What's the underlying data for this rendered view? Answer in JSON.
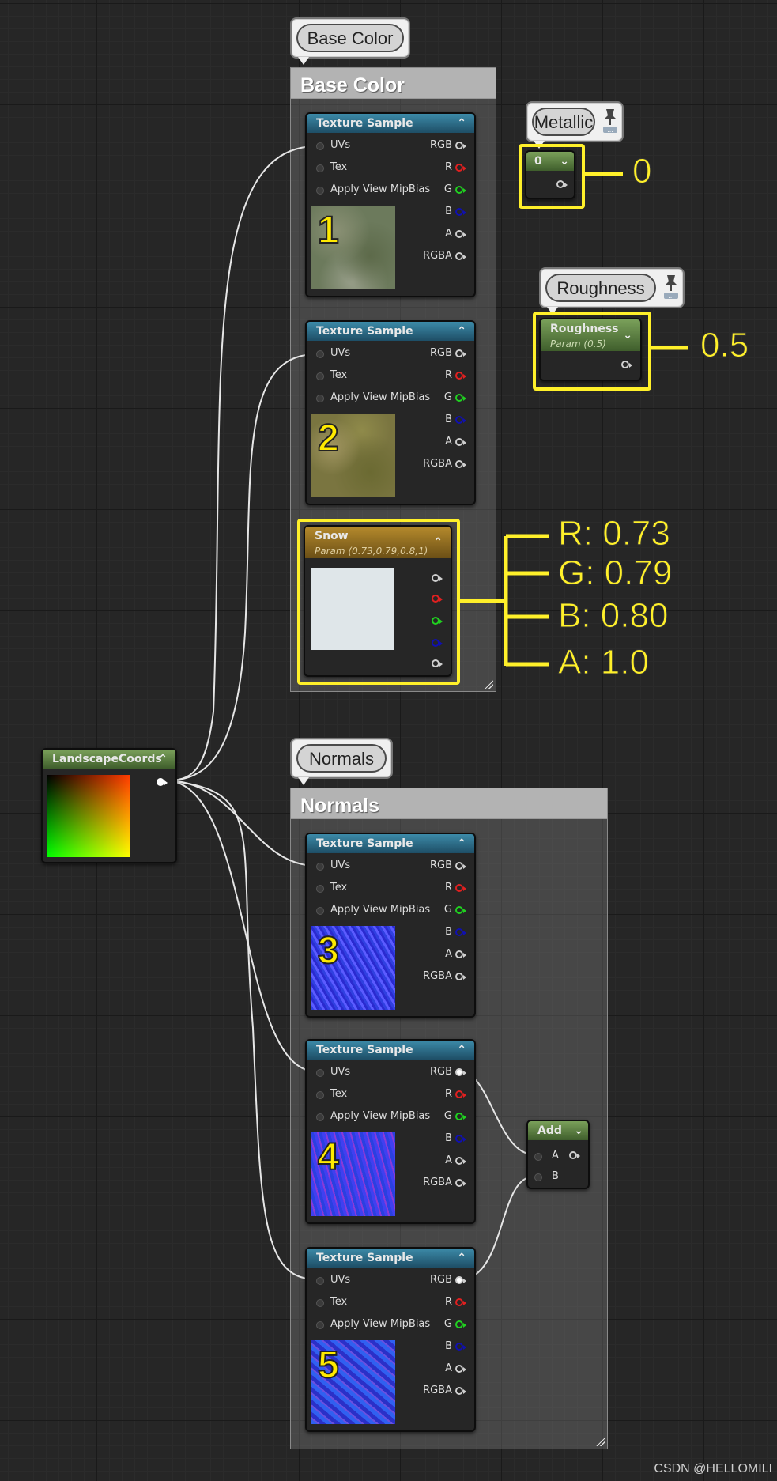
{
  "comments": {
    "base_color": "Base Color",
    "normals": "Normals"
  },
  "bubbles": {
    "base_color": "Base Color",
    "normals": "Normals",
    "metallic": "Metallic",
    "roughness": "Roughness"
  },
  "texture_node": {
    "title": "Texture Sample",
    "inputs": [
      "UVs",
      "Tex",
      "Apply View MipBias"
    ],
    "outputs": [
      "RGB",
      "R",
      "G",
      "B",
      "A",
      "RGBA"
    ]
  },
  "texture_labels": [
    "1",
    "2",
    "3",
    "4",
    "5"
  ],
  "snow_node": {
    "title": "Snow",
    "subtitle": "Param (0.73,0.79,0.8,1)"
  },
  "metallic_node": {
    "title": "0"
  },
  "roughness_node": {
    "title": "Roughness",
    "subtitle": "Param (0.5)"
  },
  "landscape_node": {
    "title": "LandscapeCoords"
  },
  "add_node": {
    "title": "Add",
    "inputs": [
      "A",
      "B"
    ]
  },
  "annotations": {
    "metallic_value": "0",
    "roughness_value": "0.5",
    "r": "R: 0.73",
    "g": "G: 0.79",
    "b": "B: 0.80",
    "a": "A: 1.0"
  },
  "colors": {
    "highlight": "#fff02a",
    "pin_red": "#e02020",
    "pin_green": "#20d020",
    "pin_blue": "#1010b0",
    "pin_white": "#cfcfcf"
  },
  "watermark": "CSDN @HELLOMILI"
}
